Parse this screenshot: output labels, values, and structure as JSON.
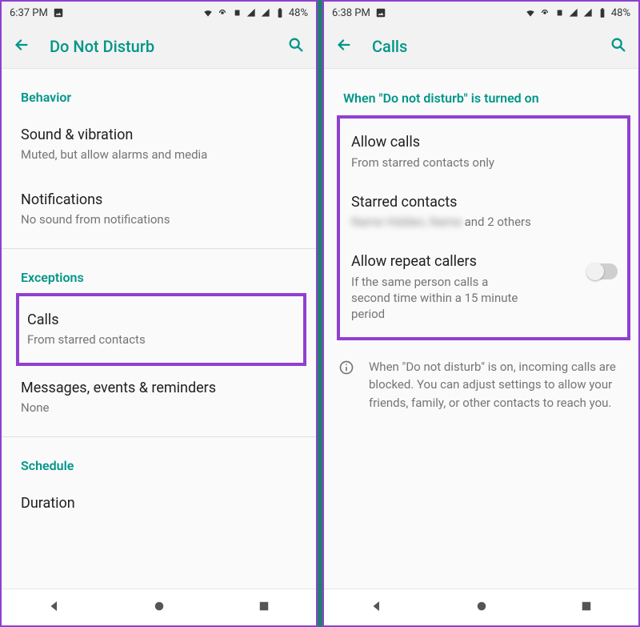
{
  "left": {
    "status_time": "6:37 PM",
    "battery": "48%",
    "title": "Do Not Disturb",
    "sections": {
      "behavior": {
        "label": "Behavior",
        "sound": {
          "title": "Sound & vibration",
          "sub": "Muted, but allow alarms and media"
        },
        "notifications": {
          "title": "Notifications",
          "sub": "No sound from notifications"
        }
      },
      "exceptions": {
        "label": "Exceptions",
        "calls": {
          "title": "Calls",
          "sub": "From starred contacts"
        },
        "messages": {
          "title": "Messages, events & reminders",
          "sub": "None"
        }
      },
      "schedule": {
        "label": "Schedule",
        "duration": {
          "title": "Duration"
        }
      }
    }
  },
  "right": {
    "status_time": "6:38 PM",
    "battery": "48%",
    "title": "Calls",
    "section_label": "When \"Do not disturb\" is turned on",
    "allow_calls": {
      "title": "Allow calls",
      "sub": "From starred contacts only"
    },
    "starred": {
      "title": "Starred contacts",
      "sub_blurred": "Name Hidden, Name",
      "sub_tail": "and 2 others"
    },
    "repeat": {
      "title": "Allow repeat callers",
      "sub": "If the same person calls a second time within a 15 minute period",
      "enabled": false
    },
    "info": "When \"Do not disturb\" is on, incoming calls are blocked. You can adjust settings to allow your friends, family, or other contacts to reach you."
  }
}
